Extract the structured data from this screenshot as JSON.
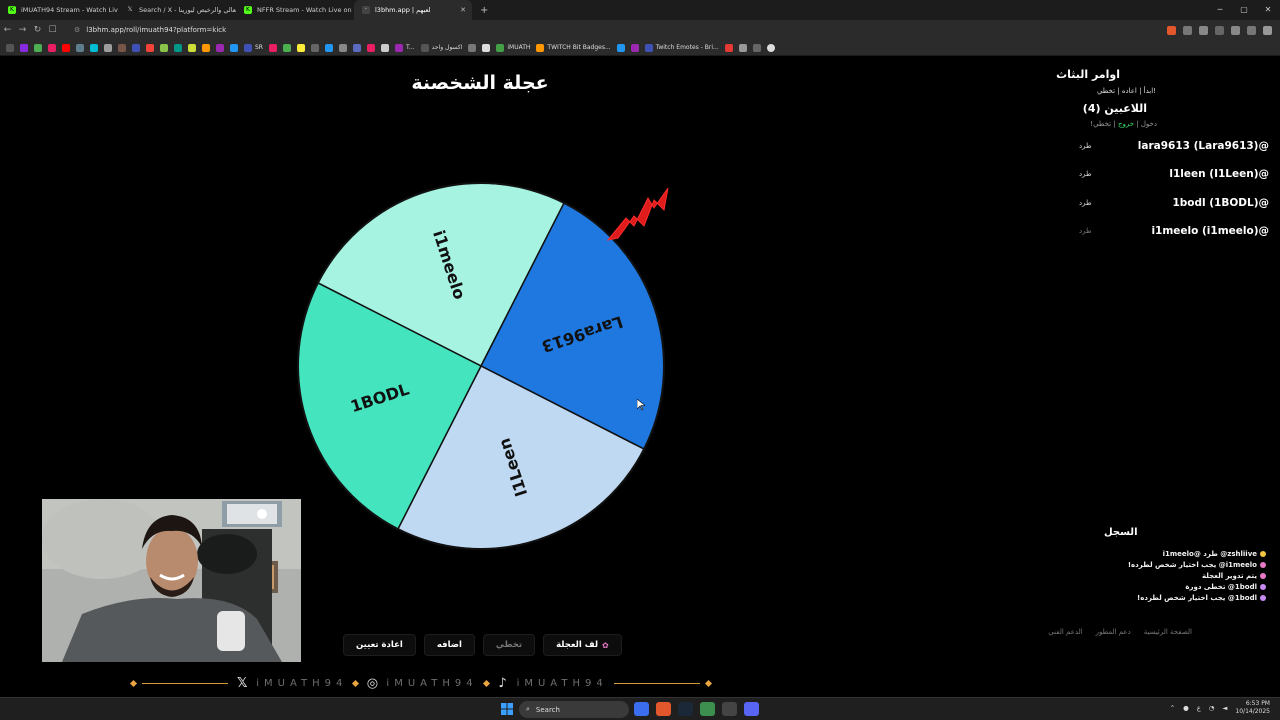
{
  "browser": {
    "tabs": [
      {
        "label": "iMUATH94 Stream - Watch Live o",
        "icon": "kick-icon",
        "color": "#53fc18",
        "active": false
      },
      {
        "label": "Search / X - العالي والرخيص ليورينا#",
        "icon": "x-icon",
        "color": "#000000",
        "active": false
      },
      {
        "label": "NFFR Stream - Watch Live on Kick",
        "icon": "kick-icon",
        "color": "#53fc18",
        "active": false
      },
      {
        "label": "l3bhm.app | لعبهم",
        "icon": "l3bhm-icon",
        "color": "#111111",
        "active": true
      }
    ],
    "new_tab": "+",
    "url": "l3bhm.app/roll/imuath94?platform=kick",
    "bookmarks": [
      "SR",
      "T...",
      "اكسول واحد",
      "iMUATH",
      "TWITCH Bit Badges...",
      "Twitch Emotes - Bri..."
    ]
  },
  "page": {
    "title": "عجلة الشخصنة"
  },
  "wheel": {
    "segments": [
      {
        "label": "i1meelo",
        "color": "#a5f3e0"
      },
      {
        "label": "Lara9613",
        "color": "#1e78df"
      },
      {
        "label": "l1Leen",
        "color": "#c0d9f3"
      },
      {
        "label": "1BODL",
        "color": "#44e4bf"
      }
    ],
    "pointer_color": "#e01b1b"
  },
  "panel": {
    "commands_title": "اوامر البثاث",
    "commands": "ابدأ | اعاده | تخطي!",
    "players_title": "اللاعبين (4)",
    "join_text_a": "دخول | ",
    "join_text_b": "خروج",
    "join_text_c": " | تخطي!",
    "players": [
      {
        "name": "lara9613 (Lara9613)@",
        "kick": "طرد",
        "dim": false
      },
      {
        "name": "l1leen (I1Leen)@",
        "kick": "طرد",
        "dim": false
      },
      {
        "name": "1bodl (1BODL)@",
        "kick": "طرد",
        "dim": false
      },
      {
        "name": "i1meelo (i1meelo)@",
        "kick": "طرد",
        "dim": true
      }
    ],
    "log_title": "السجل",
    "log": [
      {
        "text": "zshliive@ طرد @i1meelo",
        "color": "#f5c542"
      },
      {
        "text": "i1meelo@ يجب اختيار شخص لطرده!",
        "color": "#e879c7"
      },
      {
        "text": "يتم تدوير العجلة",
        "color": "#e879c7"
      },
      {
        "text": "1bodl@ تخطى دورة",
        "color": "#c78af0"
      },
      {
        "text": "1bodl@ يجب اختيار شخص لطرده!",
        "color": "#c78af0"
      }
    ],
    "footer_links": [
      "الصفحة الرئيسية",
      "دعم المطور",
      "الدعم الفني"
    ]
  },
  "controls": {
    "reset": "اعادة تعيين",
    "add": "اضافه",
    "skip": "تخطي",
    "spin": "لف العجلة"
  },
  "overlay": {
    "handle": "iMUATH94"
  },
  "taskbar": {
    "search_placeholder": "Search",
    "time": "6:53 PM",
    "date": "10/14/2025",
    "lang": "ع"
  }
}
